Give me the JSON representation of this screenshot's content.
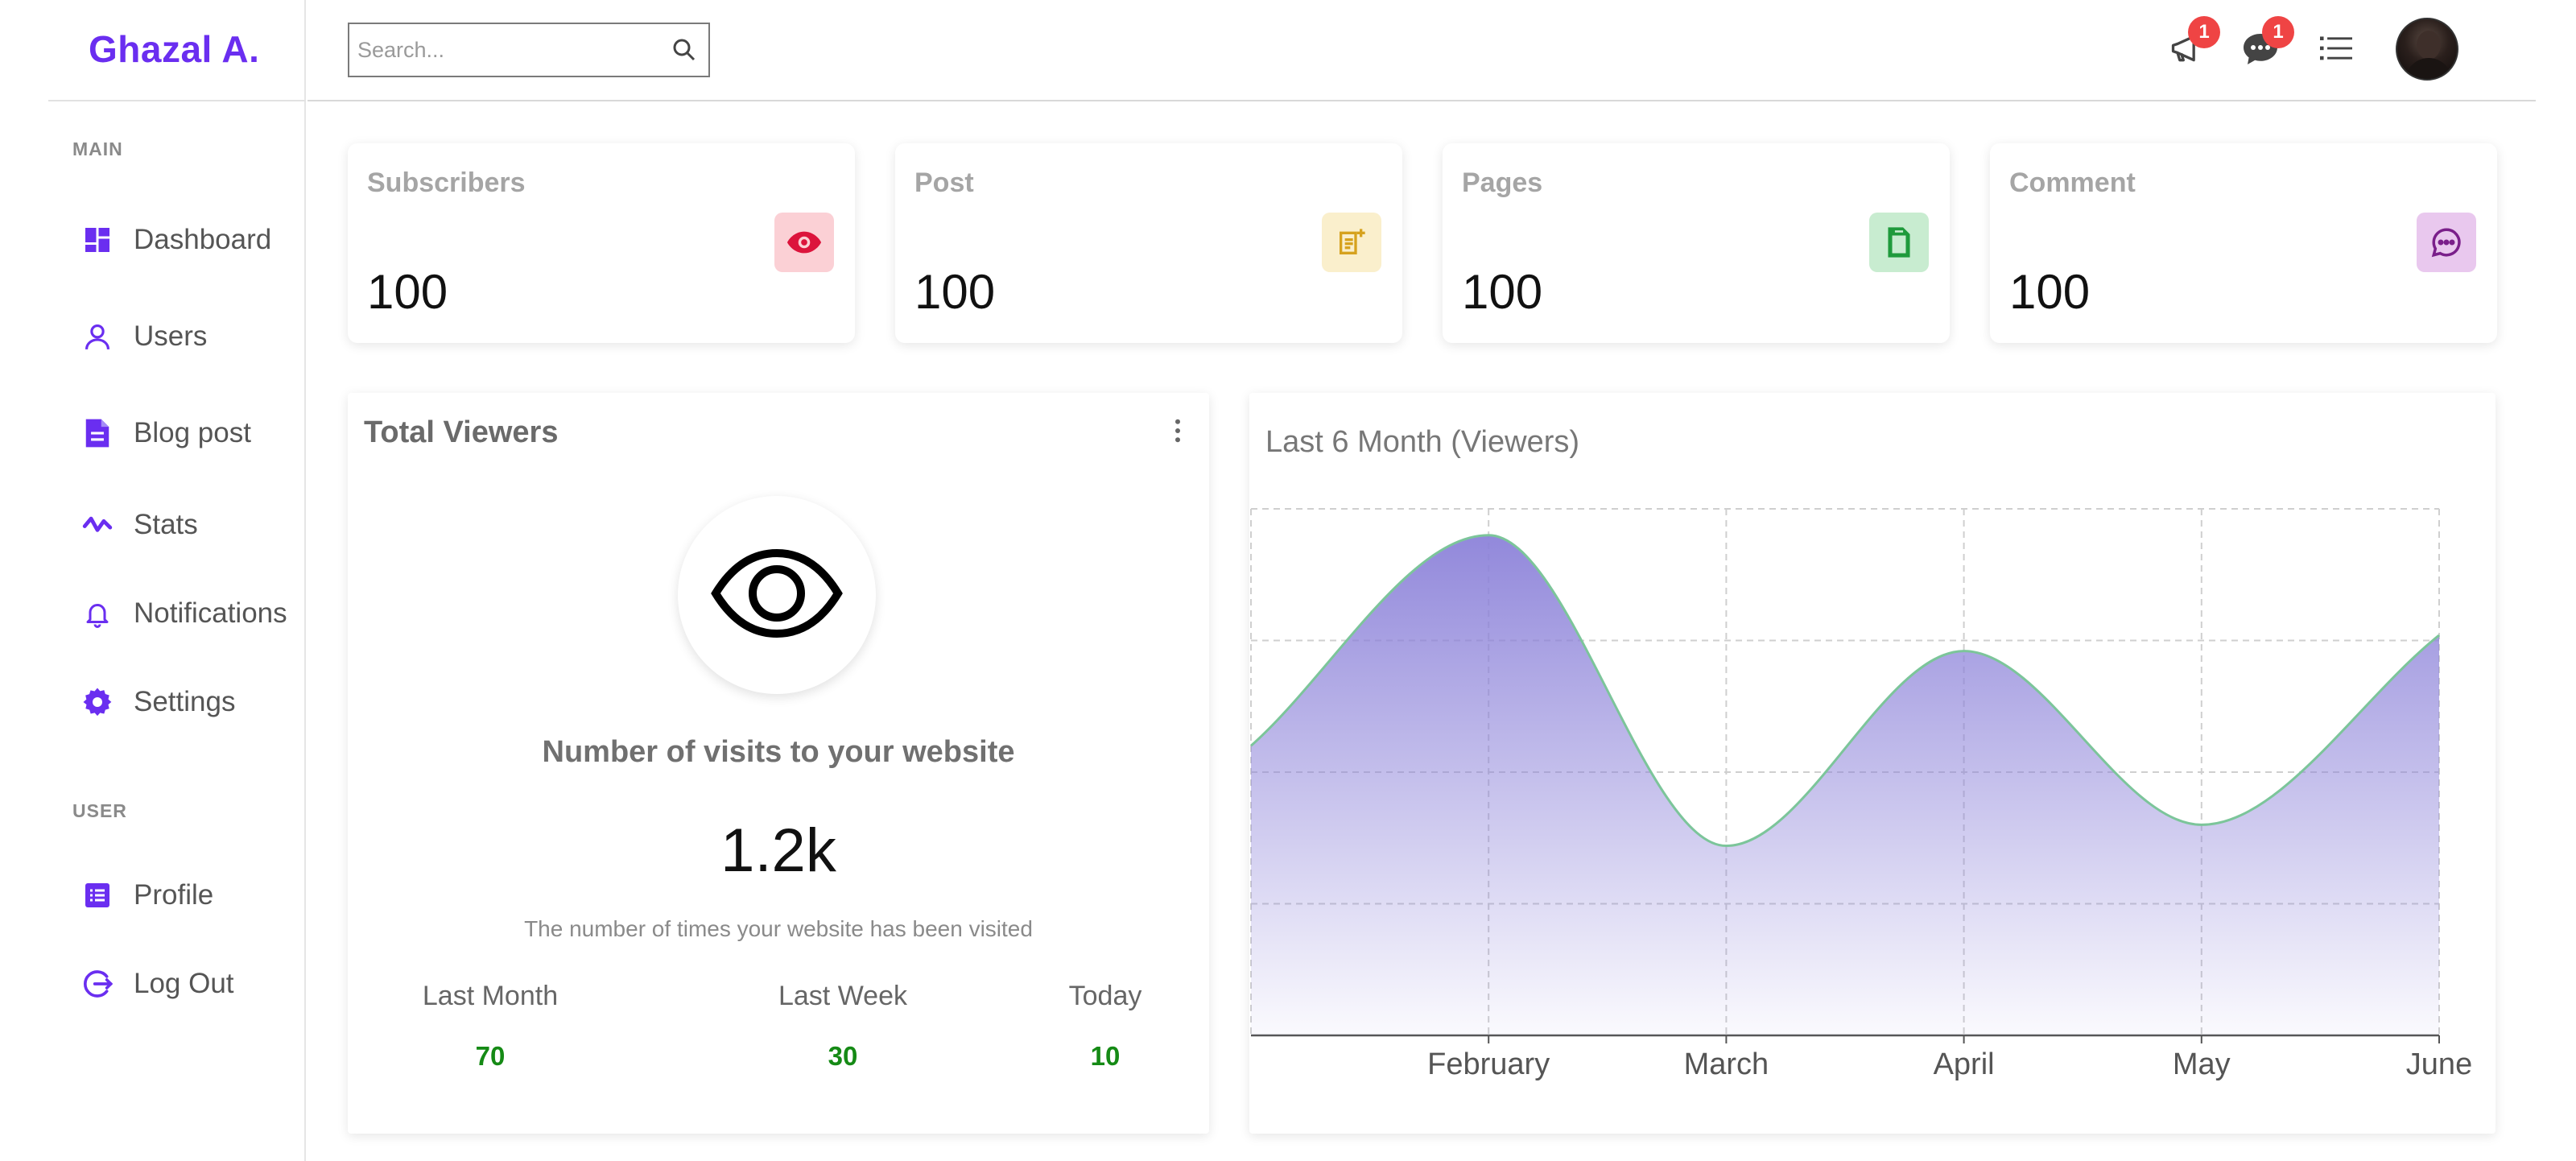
{
  "sidebar": {
    "logo": "Ghazal A.",
    "sections": {
      "main": "MAIN",
      "user": "USER"
    },
    "items": [
      {
        "label": "Dashboard",
        "icon": "dashboard-icon"
      },
      {
        "label": "Users",
        "icon": "user-icon"
      },
      {
        "label": "Blog post",
        "icon": "document-icon"
      },
      {
        "label": "Stats",
        "icon": "stats-icon"
      },
      {
        "label": "Notifications",
        "icon": "bell-icon"
      },
      {
        "label": "Settings",
        "icon": "gear-icon"
      },
      {
        "label": "Profile",
        "icon": "profile-icon"
      },
      {
        "label": "Log Out",
        "icon": "logout-icon"
      }
    ]
  },
  "topbar": {
    "search_placeholder": "Search...",
    "announcements_badge": "1",
    "messages_badge": "1"
  },
  "stats": [
    {
      "title": "Subscribers",
      "value": "100",
      "icon": "eye-icon",
      "color": "#dc143c",
      "bg": "#fbd0d5"
    },
    {
      "title": "Post",
      "value": "100",
      "icon": "note-add-icon",
      "color": "#d6a21e",
      "bg": "#faefcc"
    },
    {
      "title": "Pages",
      "value": "100",
      "icon": "page-icon",
      "color": "#1f9a3c",
      "bg": "#c8ecd0"
    },
    {
      "title": "Comment",
      "value": "100",
      "icon": "comment-icon",
      "color": "#7a1f8a",
      "bg": "#e9c8ee"
    }
  ],
  "viewers": {
    "title": "Total Viewers",
    "heading": "Number of visits to your website",
    "total": "1.2k",
    "description": "The number of times your website has been visited",
    "breakdown": [
      {
        "label": "Last Month",
        "value": "70"
      },
      {
        "label": "Last Week",
        "value": "30"
      },
      {
        "label": "Today",
        "value": "10"
      }
    ]
  },
  "colors": {
    "accent": "#6a2ef0",
    "chart_fill": "#8c82d9",
    "chart_line": "#7cc59a",
    "positive": "#158a15",
    "badge": "#ef4444"
  },
  "chart_data": {
    "type": "area",
    "title": "Last 6 Month (Viewers)",
    "categories": [
      "",
      "February",
      "March",
      "April",
      "May",
      "June"
    ],
    "values": [
      55,
      95,
      36,
      73,
      40,
      76
    ],
    "ylim": [
      0,
      100
    ],
    "grid": true
  }
}
